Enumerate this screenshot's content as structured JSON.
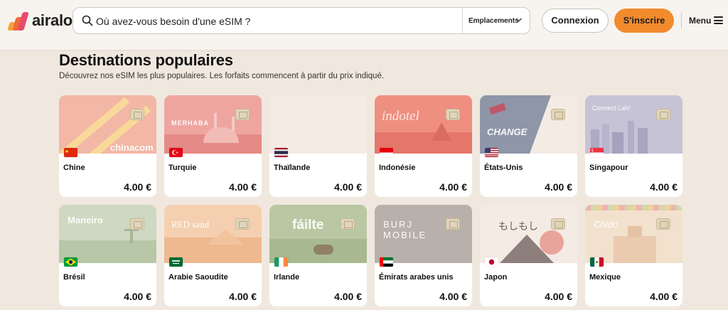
{
  "header": {
    "logo_text": "airalo",
    "search_placeholder": "Où avez-vous besoin d'une eSIM ?",
    "locations_label": "Emplacements",
    "login_label": "Connexion",
    "signup_label": "S'inscrire",
    "menu_label": "Menu"
  },
  "section": {
    "title": "Destinations populaires",
    "subtitle": "Découvrez nos eSIM les plus populaires. Les forfaits commencent à partir du prix indiqué."
  },
  "cards": [
    {
      "name": "Chine",
      "price": "4.00 €",
      "brand": "chinacom"
    },
    {
      "name": "Turquie",
      "price": "4.00 €",
      "brand": "MERHABA"
    },
    {
      "name": "Thaïlande",
      "price": "4.00 €",
      "brand": ""
    },
    {
      "name": "Indonésie",
      "price": "4.00 €",
      "brand": "indotel"
    },
    {
      "name": "États-Unis",
      "price": "4.00 €",
      "brand": "CHANGE"
    },
    {
      "name": "Singapour",
      "price": "4.00 €",
      "brand": "Connect Lah!"
    },
    {
      "name": "Brésil",
      "price": "4.00 €",
      "brand": "Maneiro"
    },
    {
      "name": "Arabie Saoudite",
      "price": "4.00 €",
      "brand": "RED sand"
    },
    {
      "name": "Irlande",
      "price": "4.00 €",
      "brand": "fáilte"
    },
    {
      "name": "Émirats arabes unis",
      "price": "4.00 €",
      "brand": "BURJ MOBILE"
    },
    {
      "name": "Japon",
      "price": "4.00 €",
      "brand": "もしもし"
    },
    {
      "name": "Mexique",
      "price": "4.00 €",
      "brand": "Chido"
    }
  ],
  "colors": {
    "accent": "#f28b2d",
    "page_bg": "#f0e8df",
    "header_bg": "#f7f3ee"
  }
}
